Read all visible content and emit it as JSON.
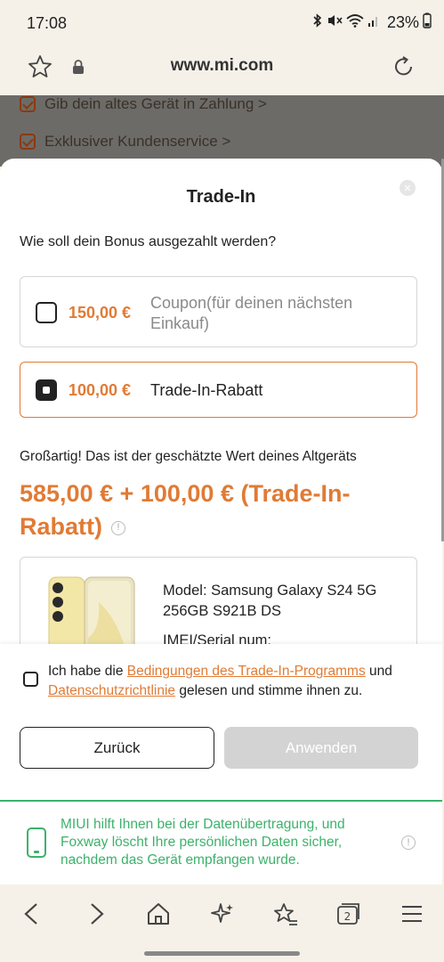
{
  "status_bar": {
    "time": "17:08",
    "battery": "23%"
  },
  "url_bar": {
    "url": "www.mi.com"
  },
  "background_page": {
    "items": [
      {
        "label": "Gib dein altes Gerät in Zahlung >"
      },
      {
        "label": "Exklusiver Kundenservice >"
      }
    ]
  },
  "dialog": {
    "title": "Trade-In",
    "close_icon": "close-icon",
    "question": "Wie soll dein Bonus ausgezahlt werden?",
    "options": [
      {
        "amount": "150,00 €",
        "label": "Coupon(für deinen nächsten Einkauf)",
        "selected": false
      },
      {
        "amount": "100,00 €",
        "label": "Trade-In-Rabatt",
        "selected": true
      }
    ],
    "estimate_label": "Großartig! Das ist der geschätzte Wert deines Altgeräts",
    "estimate_value": "585,00 € + 100,00 € (Trade-In-Rabatt)",
    "device": {
      "model": "Model: Samsung Galaxy S24 5G 256GB S921B DS",
      "imei_label": "IMEI/Serial num:"
    },
    "terms": {
      "prefix": "Ich habe die ",
      "link1": "Bedingungen des Trade-In-Programms",
      "middle": " und ",
      "link2": "Datenschutzrichtlinie",
      "suffix": " gelesen und stimme ihnen zu."
    },
    "back_button": "Zurück",
    "apply_button": "Anwenden",
    "notice": "MIUI hilft Ihnen bei der Datenübertragung, und Foxway löscht Ihre persönlichen Daten sicher, nachdem das Gerät empfangen wurde."
  },
  "bottom_nav": {
    "tabs_count": "2"
  },
  "colors": {
    "accent": "#e07b35",
    "green": "#3cb26b",
    "disabled": "#d3d3d3"
  }
}
